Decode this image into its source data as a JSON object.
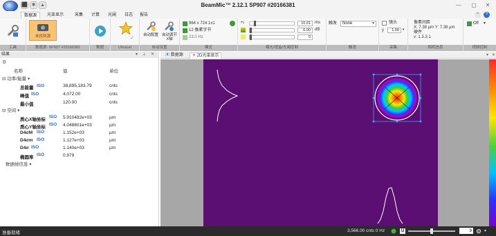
{
  "titlebar": {
    "title": "BeamMic™ 2.12.1 SP907 #20166381",
    "qa_icons": [
      "save-icon",
      "sparkle-icon",
      "capture-icon"
    ],
    "min": "—",
    "max": "▢",
    "close": "✕"
  },
  "ribbon_tabs": [
    "数据源",
    "光束显示",
    "采集",
    "计算",
    "光阑",
    "日志",
    "报告"
  ],
  "ribbon": {
    "groups": {
      "tools": "工具",
      "source": "数据源: SP907 #20166381",
      "data": "数据",
      "ultracal": "Ultracal",
      "auto_setup": "自动设置",
      "mode": "模式",
      "exposure": "曝光/增益/光阑控制",
      "trigger": "触发",
      "capture": "采集",
      "info": "相机信息",
      "frame_control": "视频控制"
    },
    "source_button": "未找到源",
    "auto_setup_labels": [
      "自动配置",
      "自动调节 X轴"
    ],
    "resolution": "964 x 724 1x1",
    "bit_depth": "12 像素字节",
    "fps": "23.0 Hz",
    "exposure": {
      "value": "10.01",
      "unit": "ms",
      "gain": "0.00",
      "gain_unit": "dB",
      "offset": "0"
    },
    "trigger": {
      "label": "触发",
      "value": "None"
    },
    "capture": {
      "checkbox_label": "镜头",
      "value": "1.00"
    },
    "camera_info": {
      "title": "像素间距",
      "pitch": "X: 7.38 µm  Y: 7.38 µm",
      "firmware_label": "硬件",
      "firmware": "v: 1.3.3.1"
    },
    "frame_toggle": "Off"
  },
  "left_panel": {
    "title": "结果",
    "columns": {
      "name": "名称",
      "value": "值",
      "unit": "单位"
    },
    "sections": {
      "energy": "功率/能量",
      "spatial": "空间",
      "frame": "数据帧信息"
    },
    "iso": "ISO",
    "energy_rows": [
      {
        "label": "总能量",
        "iso": true,
        "value": "38,895,183.79",
        "unit": "cnts"
      },
      {
        "label": "峰值",
        "iso": true,
        "value": "4,072.00",
        "unit": "cnts"
      },
      {
        "label": "最小值",
        "iso": false,
        "value": "120.00",
        "unit": "cnts"
      }
    ],
    "spatial_rows": [
      {
        "label": "质心X轴坐标",
        "iso": true,
        "value": "5.910482e+03",
        "unit": "µm"
      },
      {
        "label": "质心Y轴坐标",
        "iso": true,
        "value": "4.048801e+03",
        "unit": "µm"
      },
      {
        "label": "D4σM",
        "iso": true,
        "value": "1.152e+03",
        "unit": "µm"
      },
      {
        "label": "D4σm",
        "iso": true,
        "value": "1.127e+03",
        "unit": "µm"
      },
      {
        "label": "D4σ",
        "iso": true,
        "value": "1.140e+03",
        "unit": "µm"
      },
      {
        "label": "椭圆率",
        "iso": true,
        "value": "0.979",
        "unit": ""
      }
    ]
  },
  "doc_tabs": [
    "数据源",
    "2D光束显示"
  ],
  "statusbar": {
    "left": "准备就绪",
    "cnts": "3,566.00 cnts  0 Hz",
    "zoom": "9"
  },
  "colors": {
    "canvas_bg": "#5b0f73",
    "accent_blue": "#2b6bc9",
    "status_bg": "#2b2b2b"
  }
}
